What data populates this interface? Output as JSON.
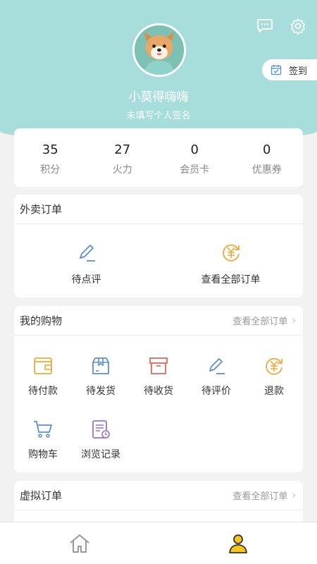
{
  "profile": {
    "username": "小莫得嗨嗨",
    "signature": "未填写个人签名",
    "signin_label": "签到"
  },
  "stats": [
    {
      "value": "35",
      "label": "积分"
    },
    {
      "value": "27",
      "label": "火力"
    },
    {
      "value": "0",
      "label": "会员卡"
    },
    {
      "value": "0",
      "label": "优惠券"
    }
  ],
  "takeout": {
    "title": "外卖订单",
    "items": [
      {
        "label": "待点评",
        "icon": "pen-icon"
      },
      {
        "label": "查看全部订单",
        "icon": "yen-refresh-icon"
      }
    ]
  },
  "shopping": {
    "title": "我的购物",
    "link": "查看全部订单",
    "items": [
      {
        "label": "待付款",
        "icon": "wallet-icon"
      },
      {
        "label": "待发货",
        "icon": "package-icon"
      },
      {
        "label": "待收货",
        "icon": "box-icon"
      },
      {
        "label": "待评价",
        "icon": "pen-icon"
      },
      {
        "label": "退款",
        "icon": "yen-refresh-icon"
      },
      {
        "label": "购物车",
        "icon": "cart-icon"
      },
      {
        "label": "浏览记录",
        "icon": "history-icon"
      }
    ]
  },
  "virtual": {
    "title": "虚拟订单",
    "link": "查看全部订单"
  },
  "colors": {
    "header": "#a7dedc",
    "accent_orange": "#f0a93a",
    "accent_blue": "#5a8fd8",
    "accent_red": "#e06a5a",
    "accent_purple": "#9a6fd0",
    "active_tab": "#f5c518"
  }
}
